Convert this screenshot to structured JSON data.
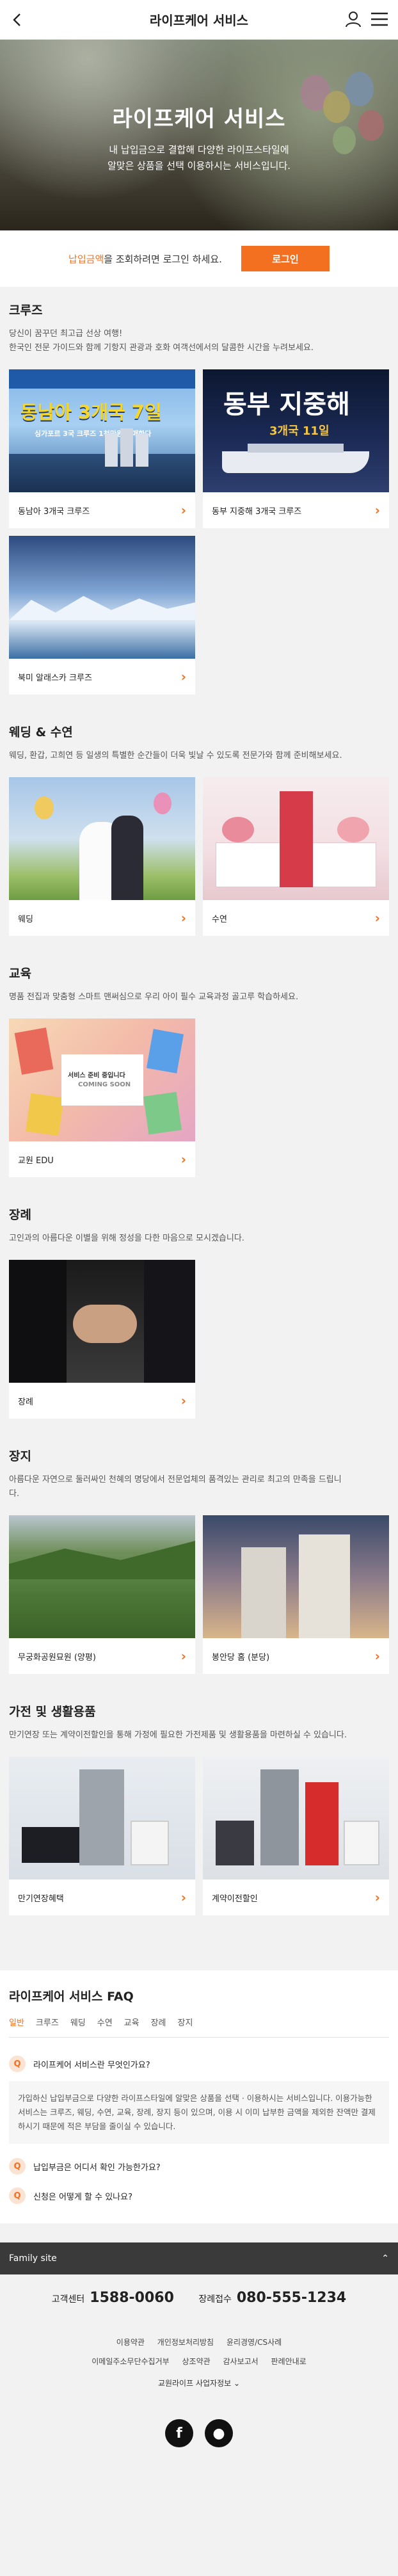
{
  "header": {
    "title": "라이프케어 서비스"
  },
  "hero": {
    "title": "라이프케어 서비스",
    "line1": "내 납입금으로 결합해 다양한 라이프스타일에",
    "line2": "알맞은 상품을 선택 이용하시는 서비스입니다."
  },
  "login": {
    "highlight": "납입금액",
    "text": "을 조회하려면 로그인 하세요.",
    "button": "로그인"
  },
  "sections": {
    "cruise": {
      "title": "크루즈",
      "desc1": "당신이 꿈꾸던 최고급 선상 여행!",
      "desc2": "한국인 전문 가이드와 함께 기항지 관광과 호화 여객선에서의 달콤한 시간을 누려보세요.",
      "cards": [
        {
          "label": "동남아 3개국 크루즈",
          "art_title": "동남아 3개국 7일",
          "art_sub": "싱가포르 3국 크루즈 1천만원 판매한다"
        },
        {
          "label": "동부 지중해 3개국 크루즈",
          "art_title": "동부 지중해",
          "art_sub": "3개국 11일"
        },
        {
          "label": "북미 알래스카 크루즈"
        }
      ]
    },
    "wedding": {
      "title": "웨딩 & 수연",
      "desc": "웨딩, 환갑, 고희연 등 일생의 특별한 순간들이 더욱 빛날 수 있도록 전문가와 함께 준비해보세요.",
      "cards": [
        {
          "label": "웨딩"
        },
        {
          "label": "수연"
        }
      ]
    },
    "education": {
      "title": "교육",
      "desc": "명품 전집과 맞춤형 스마트 맨써심으로 우리 아이 필수 교육과정 골고루 학습하세요.",
      "cards": [
        {
          "label": "교원 EDU",
          "art_title": "서비스 준비 중입니다",
          "art_sub": "COMING SOON"
        }
      ]
    },
    "funeral": {
      "title": "장례",
      "desc": "고인과의 아름다운 이별을 위해 정성을 다한 마음으로 모시겠습니다.",
      "cards": [
        {
          "label": "장례"
        }
      ]
    },
    "burial": {
      "title": "장지",
      "desc1": "아름다운 자연으로 둘러싸인 천혜의 명당에서 전문업체의 품격있는 관리로 최고의 만족을 드립니",
      "desc2": "다.",
      "cards": [
        {
          "label": "무궁화공원묘원 (양평)"
        },
        {
          "label": "봉안당 홈 (분당)"
        }
      ]
    },
    "appliance": {
      "title": "가전 및 생활용품",
      "desc": "만기연장 또는 계약이전할인을 통해 가정에 필요한 가전제품 및 생활용품을 마련하실 수 있습니다.",
      "cards": [
        {
          "label": "만기연장혜택"
        },
        {
          "label": "계약이전할인"
        }
      ]
    }
  },
  "faq": {
    "title": "라이프케어 서비스 FAQ",
    "tabs": [
      "일반",
      "크루즈",
      "웨딩",
      "수연",
      "교육",
      "장례",
      "장지"
    ],
    "items": [
      {
        "mark": "Q",
        "q": "라이프케어 서비스란 무엇인가요?"
      },
      {
        "mark": "Q",
        "q": "납입부금은 어디서 확인 가능한가요?"
      },
      {
        "mark": "Q",
        "q": "신청은 어떻게 할 수 있나요?"
      }
    ],
    "answer": "가입하신 납입부금으로 다양한 라이프스타일에 알맞은 상품을 선택 · 이용하시는 서비스입니다. 이용가능한 서비스는 크루즈, 웨딩, 수연, 교육, 장례, 장지 등이 있으며, 이용 시 이미 납부한 금액을 제외한 잔액만 결제하시기 때문에 적은 부담을 줄이실 수 있습니다."
  },
  "footer": {
    "family": "Family site",
    "tel1_label": "고객센터",
    "tel1": "1588-0060",
    "tel2_label": "장례접수",
    "tel2": "080-555-1234",
    "links": [
      "이용약관",
      "개인정보처리방침",
      "윤리경영/CS사례",
      "이메일주소무단수집거부",
      "상조약관",
      "감사보고서",
      "판례안내로"
    ],
    "family_label": "교원라이프 사업자정보",
    "colors": {
      "accent": "#f37021"
    }
  }
}
